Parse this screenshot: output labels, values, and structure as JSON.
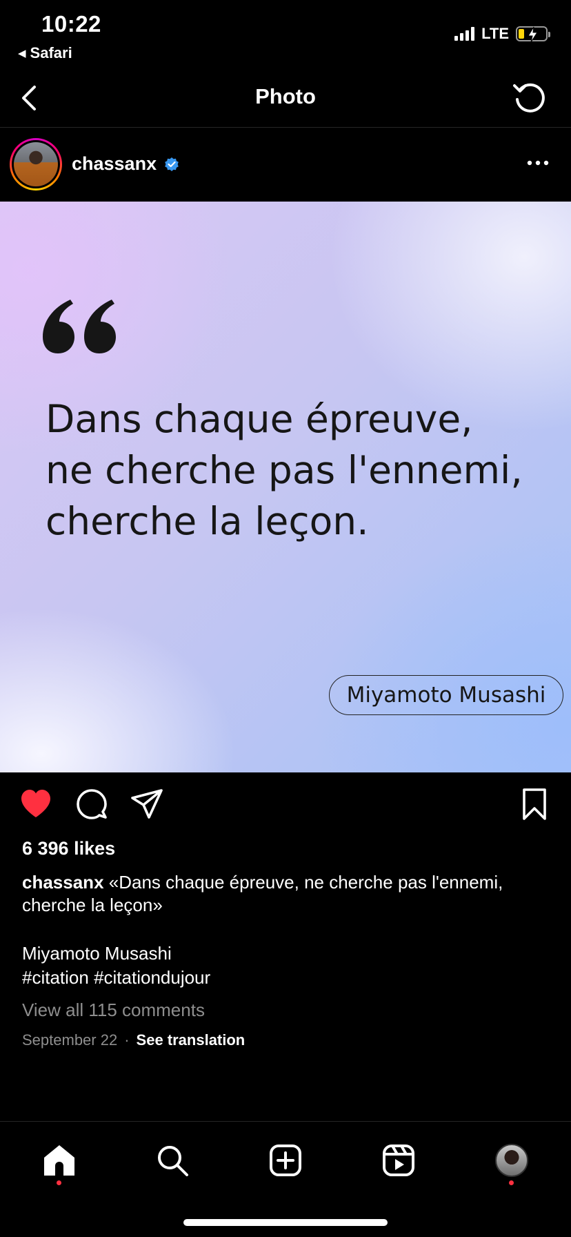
{
  "status_bar": {
    "time": "10:22",
    "back_app": "Safari",
    "network": "LTE",
    "battery_level": 0.2,
    "battery_color": "#ffd60a"
  },
  "nav": {
    "title": "Photo",
    "back_icon": "chevron-left-icon",
    "refresh_icon": "refresh-icon"
  },
  "post": {
    "username": "chassanx",
    "verified": true,
    "verified_color": "#3897f0",
    "quote_text": "Dans chaque épreuve, ne cherche pas l'ennemi, cherche la leçon.",
    "quote_author": "Miyamoto Musashi",
    "like_color": "#ff3040",
    "liked": true,
    "likes": "6 396 likes",
    "caption_user": "chassanx",
    "caption_text": "«Dans chaque épreuve, ne cherche pas l'ennemi, cherche la leçon»",
    "caption_author": "Miyamoto Musashi",
    "caption_tags": "#citation #citationdujour",
    "view_comments": "View all 115 comments",
    "date": "September 22",
    "separator": "·",
    "see_translation": "See translation"
  },
  "tabbar": {
    "items": [
      "home-icon",
      "search-icon",
      "create-icon",
      "reels-icon",
      "profile-avatar"
    ],
    "notification_color": "#ff3040"
  }
}
